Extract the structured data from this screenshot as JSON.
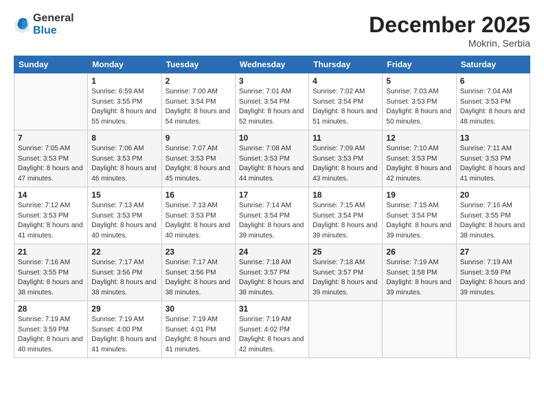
{
  "header": {
    "logo_general": "General",
    "logo_blue": "Blue",
    "month_year": "December 2025",
    "location": "Mokrin, Serbia"
  },
  "weekdays": [
    "Sunday",
    "Monday",
    "Tuesday",
    "Wednesday",
    "Thursday",
    "Friday",
    "Saturday"
  ],
  "weeks": [
    [
      {
        "day": "",
        "sunrise": "",
        "sunset": "",
        "daylight": ""
      },
      {
        "day": "1",
        "sunrise": "6:59 AM",
        "sunset": "3:55 PM",
        "daylight": "8 hours and 55 minutes."
      },
      {
        "day": "2",
        "sunrise": "7:00 AM",
        "sunset": "3:54 PM",
        "daylight": "8 hours and 54 minutes."
      },
      {
        "day": "3",
        "sunrise": "7:01 AM",
        "sunset": "3:54 PM",
        "daylight": "8 hours and 52 minutes."
      },
      {
        "day": "4",
        "sunrise": "7:02 AM",
        "sunset": "3:54 PM",
        "daylight": "8 hours and 51 minutes."
      },
      {
        "day": "5",
        "sunrise": "7:03 AM",
        "sunset": "3:53 PM",
        "daylight": "8 hours and 50 minutes."
      },
      {
        "day": "6",
        "sunrise": "7:04 AM",
        "sunset": "3:53 PM",
        "daylight": "8 hours and 48 minutes."
      }
    ],
    [
      {
        "day": "7",
        "sunrise": "7:05 AM",
        "sunset": "3:53 PM",
        "daylight": "8 hours and 47 minutes."
      },
      {
        "day": "8",
        "sunrise": "7:06 AM",
        "sunset": "3:53 PM",
        "daylight": "8 hours and 46 minutes."
      },
      {
        "day": "9",
        "sunrise": "7:07 AM",
        "sunset": "3:53 PM",
        "daylight": "8 hours and 45 minutes."
      },
      {
        "day": "10",
        "sunrise": "7:08 AM",
        "sunset": "3:53 PM",
        "daylight": "8 hours and 44 minutes."
      },
      {
        "day": "11",
        "sunrise": "7:09 AM",
        "sunset": "3:53 PM",
        "daylight": "8 hours and 43 minutes."
      },
      {
        "day": "12",
        "sunrise": "7:10 AM",
        "sunset": "3:53 PM",
        "daylight": "8 hours and 42 minutes."
      },
      {
        "day": "13",
        "sunrise": "7:11 AM",
        "sunset": "3:53 PM",
        "daylight": "8 hours and 41 minutes."
      }
    ],
    [
      {
        "day": "14",
        "sunrise": "7:12 AM",
        "sunset": "3:53 PM",
        "daylight": "8 hours and 41 minutes."
      },
      {
        "day": "15",
        "sunrise": "7:13 AM",
        "sunset": "3:53 PM",
        "daylight": "8 hours and 40 minutes."
      },
      {
        "day": "16",
        "sunrise": "7:13 AM",
        "sunset": "3:53 PM",
        "daylight": "8 hours and 40 minutes."
      },
      {
        "day": "17",
        "sunrise": "7:14 AM",
        "sunset": "3:54 PM",
        "daylight": "8 hours and 39 minutes."
      },
      {
        "day": "18",
        "sunrise": "7:15 AM",
        "sunset": "3:54 PM",
        "daylight": "8 hours and 39 minutes."
      },
      {
        "day": "19",
        "sunrise": "7:15 AM",
        "sunset": "3:54 PM",
        "daylight": "8 hours and 39 minutes."
      },
      {
        "day": "20",
        "sunrise": "7:16 AM",
        "sunset": "3:55 PM",
        "daylight": "8 hours and 38 minutes."
      }
    ],
    [
      {
        "day": "21",
        "sunrise": "7:16 AM",
        "sunset": "3:55 PM",
        "daylight": "8 hours and 38 minutes."
      },
      {
        "day": "22",
        "sunrise": "7:17 AM",
        "sunset": "3:56 PM",
        "daylight": "8 hours and 38 minutes."
      },
      {
        "day": "23",
        "sunrise": "7:17 AM",
        "sunset": "3:56 PM",
        "daylight": "8 hours and 38 minutes."
      },
      {
        "day": "24",
        "sunrise": "7:18 AM",
        "sunset": "3:57 PM",
        "daylight": "8 hours and 38 minutes."
      },
      {
        "day": "25",
        "sunrise": "7:18 AM",
        "sunset": "3:57 PM",
        "daylight": "8 hours and 39 minutes."
      },
      {
        "day": "26",
        "sunrise": "7:19 AM",
        "sunset": "3:58 PM",
        "daylight": "8 hours and 39 minutes."
      },
      {
        "day": "27",
        "sunrise": "7:19 AM",
        "sunset": "3:59 PM",
        "daylight": "8 hours and 39 minutes."
      }
    ],
    [
      {
        "day": "28",
        "sunrise": "7:19 AM",
        "sunset": "3:59 PM",
        "daylight": "8 hours and 40 minutes."
      },
      {
        "day": "29",
        "sunrise": "7:19 AM",
        "sunset": "4:00 PM",
        "daylight": "8 hours and 41 minutes."
      },
      {
        "day": "30",
        "sunrise": "7:19 AM",
        "sunset": "4:01 PM",
        "daylight": "8 hours and 41 minutes."
      },
      {
        "day": "31",
        "sunrise": "7:19 AM",
        "sunset": "4:02 PM",
        "daylight": "8 hours and 42 minutes."
      },
      {
        "day": "",
        "sunrise": "",
        "sunset": "",
        "daylight": ""
      },
      {
        "day": "",
        "sunrise": "",
        "sunset": "",
        "daylight": ""
      },
      {
        "day": "",
        "sunrise": "",
        "sunset": "",
        "daylight": ""
      }
    ]
  ]
}
